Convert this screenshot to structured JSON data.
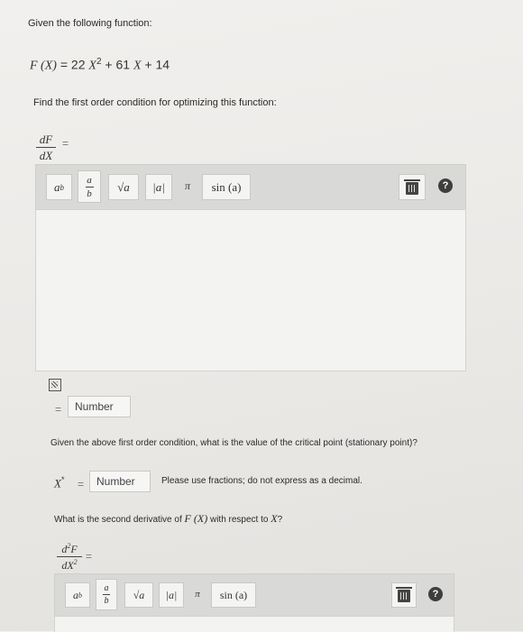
{
  "question_intro": "Given the following function:",
  "function": {
    "lhs": "F (X)",
    "equals": "=",
    "coef2": "22",
    "var": "X",
    "exp": "2",
    "plus1": "+",
    "coef1": "61",
    "var1": "X",
    "plus2": "+",
    "const": "14"
  },
  "foc_prompt": "Find the first order condition for optimizing this function:",
  "first_derivative": {
    "num": "dF",
    "den": "dX",
    "equals": "="
  },
  "toolbar": {
    "power": {
      "base": "a",
      "exp": "b"
    },
    "fraction": {
      "num": "a",
      "den": "b"
    },
    "sqrt": "√a",
    "abs": "|a|",
    "pi": "π",
    "sin": "sin (a)",
    "help": "?"
  },
  "foc_answer": {
    "equals": "=",
    "placeholder": "Number"
  },
  "critical_prompt": "Given the above first order condition, what is the value of the critical point (stationary point)?",
  "critical": {
    "label": "X",
    "star": "*",
    "equals": "=",
    "placeholder": "Number",
    "note": "Please use fractions; do not express as a decimal."
  },
  "second_prompt": {
    "before": "What is the second derivative of",
    "fx": "F (X)",
    "middle": "with respect to",
    "var": "X",
    "after": "?"
  },
  "second_derivative": {
    "num": "d",
    "num_exp": "2",
    "num_var": "F",
    "den": "dX",
    "den_exp": "2",
    "equals": "="
  }
}
